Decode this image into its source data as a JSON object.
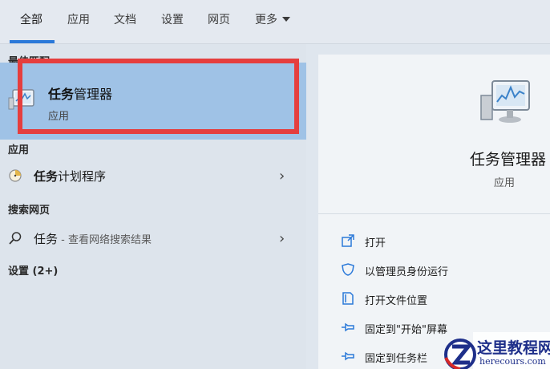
{
  "tabs": [
    {
      "label": "全部",
      "active": true
    },
    {
      "label": "应用"
    },
    {
      "label": "文档"
    },
    {
      "label": "设置"
    },
    {
      "label": "网页"
    },
    {
      "label": "更多"
    }
  ],
  "left": {
    "best_match_header": "最佳匹配",
    "best_match": {
      "title_bold": "任务",
      "title_rest": "管理器",
      "subtitle": "应用"
    },
    "apps_header": "应用",
    "app_item": {
      "bold": "任务",
      "rest": "计划程序"
    },
    "web_header": "搜索网页",
    "web_item": {
      "bold": "任务",
      "rest": " - 查看网络搜索结果"
    },
    "settings_header": "设置 (2+)"
  },
  "right": {
    "title": "任务管理器",
    "subtitle": "应用",
    "actions": [
      {
        "label": "打开",
        "icon": "open-icon"
      },
      {
        "label": "以管理员身份运行",
        "icon": "shield-icon"
      },
      {
        "label": "打开文件位置",
        "icon": "file-location-icon"
      },
      {
        "label": "固定到\"开始\"屏幕",
        "icon": "pin-icon"
      },
      {
        "label": "固定到任务栏",
        "icon": "pin-icon"
      }
    ]
  },
  "watermark": {
    "name": "这里教程网",
    "url": "herecours.com"
  },
  "colors": {
    "accent": "#2b79d9",
    "highlight": "#9fc2e6",
    "red_box": "#e53e3e"
  }
}
